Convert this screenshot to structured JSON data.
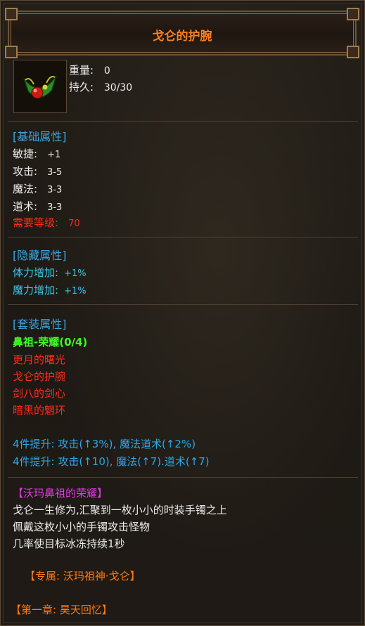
{
  "item": {
    "name": "戈仑的护腕",
    "icon": "bracer-icon",
    "weight_label": "重量:",
    "weight_value": "0",
    "durability_label": "持久:",
    "durability_value": "30/30"
  },
  "basic": {
    "header": "[基础属性]",
    "rows": [
      {
        "label": "敏捷:",
        "value": "+1"
      },
      {
        "label": "攻击:",
        "value": "3-5"
      },
      {
        "label": "魔法:",
        "value": "3-3"
      },
      {
        "label": "道术:",
        "value": "3-3"
      }
    ],
    "req_label": "需要等级:",
    "req_value": "70"
  },
  "hidden": {
    "header": "[隐藏属性]",
    "rows": [
      {
        "label": "体力增加:",
        "value": "+1%"
      },
      {
        "label": "魔力增加:",
        "value": "+1%"
      }
    ]
  },
  "set": {
    "header": "[套装属性]",
    "name": "鼻祖-荣耀(0/4)",
    "pieces": [
      "更月的曙光",
      "戈仑的护腕",
      "剑八的剑心",
      "暗黑的魍环"
    ],
    "bonuses": [
      "4件提升: 攻击(↑3%), 魔法道术(↑2%)",
      "4件提升: 攻击(↑10), 魔法(↑7).道术(↑7)"
    ]
  },
  "lore": {
    "title": "【沃玛鼻祖的荣耀】",
    "lines": [
      "戈仑一生修为,汇聚到一枚小小的时装手镯之上",
      "佩戴这枚小小的手镯攻击怪物",
      "几率使目标冰冻持续1秒"
    ],
    "exclusive": "【专属: 沃玛祖神·戈仑】",
    "chapter": "【第一章: 昊天回忆】"
  },
  "colors": {
    "title": "#ff7e1c",
    "section": "#3ea6e0",
    "requirement": "#ff2a1a",
    "hidden_stat": "#39c8e6",
    "set_name": "#3cff22",
    "set_piece": "#ff2a1a",
    "set_bonus": "#2aa7e8",
    "lore_title": "#e03be6",
    "exclusive": "#ff7a12"
  }
}
